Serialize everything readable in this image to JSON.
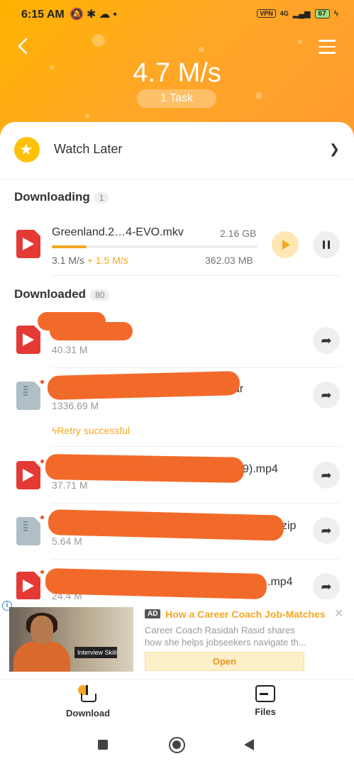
{
  "status_bar": {
    "time": "6:15 AM",
    "notification_icons": "🔕✱☁•",
    "vpn": "VPN",
    "network": "4G",
    "battery": "67"
  },
  "header": {
    "speed": "4.7 M/s",
    "task_count": "1 Task"
  },
  "watch_later": {
    "label": "Watch Later"
  },
  "downloading": {
    "title": "Downloading",
    "count": "1",
    "item": {
      "name": "Greenland.2…4-EVO.mkv",
      "total_size": "2.16 GB",
      "speed": "3.1 M/s",
      "speed_extra": "+ 1.5 M/s",
      "downloaded": "362.03 MB",
      "progress": 0.17
    }
  },
  "downloaded": {
    "title": "Downloaded",
    "count": "80",
    "items": [
      {
        "name_visible": "c",
        "size": "40.31 M",
        "type": "video"
      },
      {
        "name_visible": "ar",
        "size": "1336.69 M",
        "type": "zip",
        "note": "Retry successful"
      },
      {
        "name_visible": "9).mp4",
        "size": "37.71 M",
        "type": "video"
      },
      {
        "name_visible": "zip",
        "size": "5.64 M",
        "type": "zip"
      },
      {
        "name_visible": ".mp4",
        "size": "24.4 M",
        "type": "video"
      }
    ]
  },
  "ad": {
    "badge": "AD",
    "title": "How a Career Coach Job-Matches",
    "desc_line1": "Career Coach Rasidah Rasid shares",
    "desc_line2": "how she helps jobseekers navigate th...",
    "open_label": "Open",
    "image_sign": "Interview Skills"
  },
  "bottom_nav": {
    "download_label": "Download",
    "files_label": "Files"
  },
  "colors": {
    "accent": "#f5a623",
    "header_start": "#ffb300",
    "header_end": "#ff9a2e",
    "video_icon": "#e53935",
    "redaction": "#f26a2a"
  }
}
